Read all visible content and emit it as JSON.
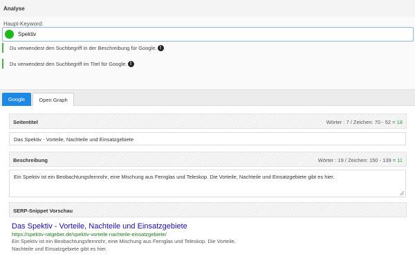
{
  "analyse": {
    "heading": "Analyse"
  },
  "keyword": {
    "label": "Haupt-Keyword:",
    "value": "Spektiv",
    "status_color": "#1fb81f"
  },
  "notices": [
    {
      "text": "Du verwendest den Suchbegriff in der Beschreibung für Google.",
      "icon": "!"
    },
    {
      "text": "Du verwendest den Suchbegriff im Titel für Google.",
      "icon": "!"
    }
  ],
  "tabs": [
    {
      "label": "Google",
      "active": true
    },
    {
      "label": "Open Graph",
      "active": false
    }
  ],
  "seitentitel": {
    "heading": "Seitentitel",
    "stats_prefix": "Wörter : 7 / Zeichen: 70 - 52 =",
    "stats_result": "18",
    "value": "Das Spektiv - Vorteile, Nachteile und Einsatzgebiete"
  },
  "beschreibung": {
    "heading": "Beschreibung",
    "stats_prefix": "Wörter : 19 / Zeichen: 150 - 139 =",
    "stats_result": "11",
    "value": "Ein Spektiv ist ein Beobachtungsfernrohr, eine Mischung aus Fernglas und Teleskop. Die Vorteile, Nachteile und Einsatzgebiete gibt es hier."
  },
  "serp": {
    "heading": "SERP-Snippet Vorschau",
    "title": "Das Spektiv - Vorteile, Nachteile und Einsatzgebiete",
    "url": "https://spektiv-ratgeber.de/spektiv-vorteile-nachteile-einsatzgebiete/",
    "description": "Ein Spektiv ist ein Beobachtungsfernrohr, eine Mischung aus Fernglas und Teleskop. Die Vorteile, Nachteile und Einsatzgebiete gibt es hier."
  },
  "colors": {
    "accent": "#1e88e5",
    "success": "#3fb73f",
    "serp_title": "#1a0dab",
    "serp_url": "#1a7a1a"
  }
}
